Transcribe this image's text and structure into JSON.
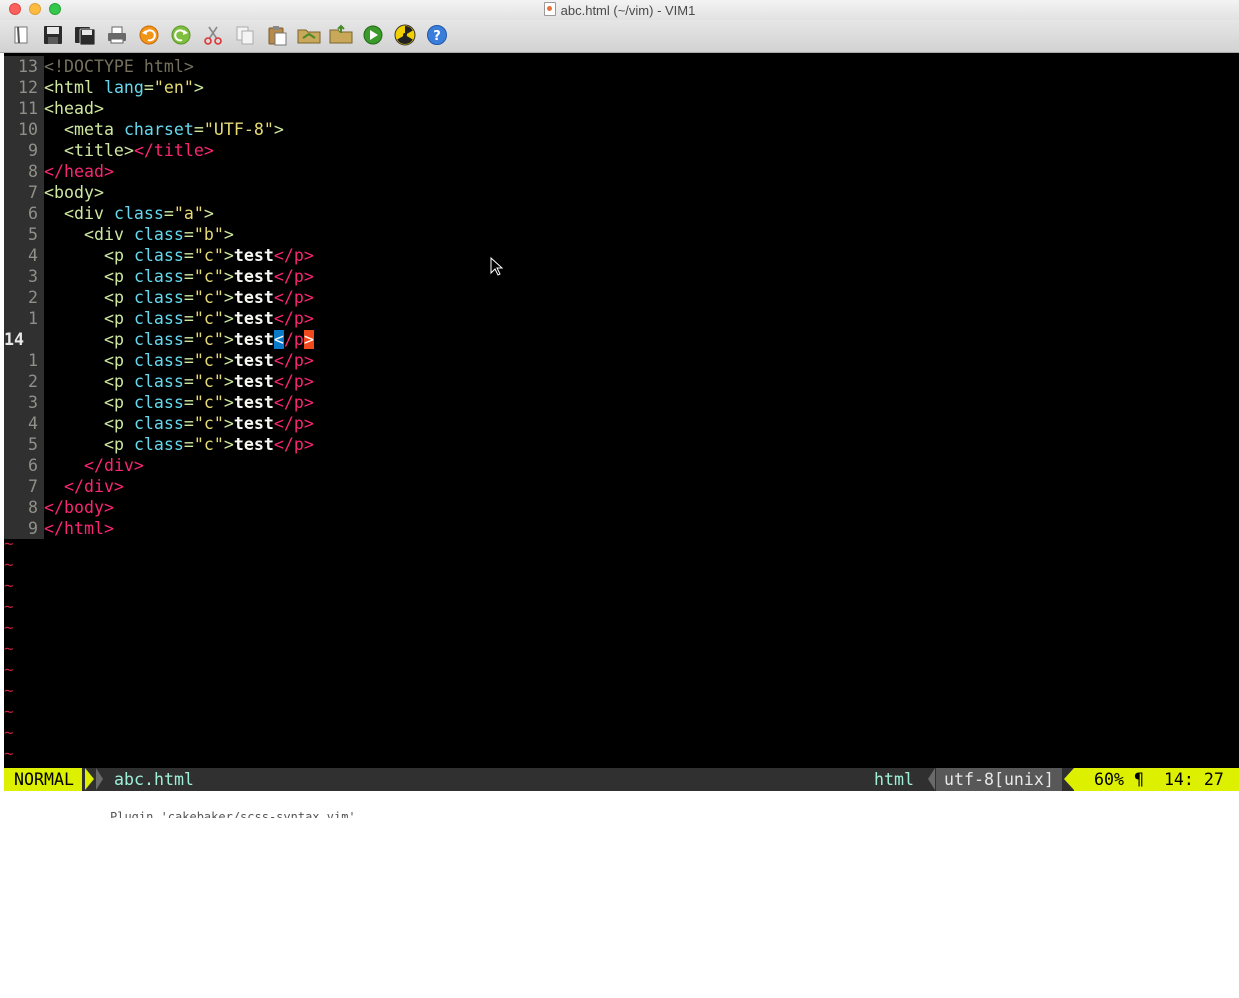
{
  "window": {
    "title": "abc.html (~/vim) - VIM1"
  },
  "toolbar": {
    "buttons": [
      {
        "name": "open-icon"
      },
      {
        "name": "save-icon"
      },
      {
        "name": "save-all-icon"
      },
      {
        "name": "print-icon"
      },
      {
        "name": "undo-icon"
      },
      {
        "name": "redo-icon"
      },
      {
        "name": "cut-icon"
      },
      {
        "name": "copy-icon"
      },
      {
        "name": "paste-icon"
      },
      {
        "name": "load-session-icon"
      },
      {
        "name": "save-session-icon"
      },
      {
        "name": "run-icon"
      },
      {
        "name": "radiation-icon"
      },
      {
        "name": "help-icon"
      }
    ]
  },
  "editor": {
    "lines": [
      {
        "num": "13",
        "text": "<!DOCTYPE html>"
      },
      {
        "num": "12",
        "text": "<html lang=\"en\">"
      },
      {
        "num": "11",
        "text": "<head>"
      },
      {
        "num": "10",
        "text": "  <meta charset=\"UTF-8\">"
      },
      {
        "num": "9",
        "text": "  <title></title>"
      },
      {
        "num": "8",
        "text": "</head>"
      },
      {
        "num": "7",
        "text": "<body>"
      },
      {
        "num": "6",
        "text": "  <div class=\"a\">"
      },
      {
        "num": "5",
        "text": "    <div class=\"b\">"
      },
      {
        "num": "4",
        "text": "      <p class=\"c\">test</p>"
      },
      {
        "num": "3",
        "text": "      <p class=\"c\">test</p>"
      },
      {
        "num": "2",
        "text": "      <p class=\"c\">test</p>"
      },
      {
        "num": "1",
        "text": "      <p class=\"c\">test</p>"
      },
      {
        "num": "14",
        "text": "      <p class=\"c\">test</p>",
        "current": true
      },
      {
        "num": "1",
        "text": "      <p class=\"c\">test</p>"
      },
      {
        "num": "2",
        "text": "      <p class=\"c\">test</p>"
      },
      {
        "num": "3",
        "text": "      <p class=\"c\">test</p>"
      },
      {
        "num": "4",
        "text": "      <p class=\"c\">test</p>"
      },
      {
        "num": "5",
        "text": "      <p class=\"c\">test</p>"
      },
      {
        "num": "6",
        "text": "    </div>"
      },
      {
        "num": "7",
        "text": "  </div>"
      },
      {
        "num": "8",
        "text": "</body>"
      },
      {
        "num": "9",
        "text": "</html>"
      }
    ],
    "tilde": "~",
    "tilde_count": 11
  },
  "statusline": {
    "mode": "NORMAL",
    "filename": "abc.html",
    "filetype": "html",
    "encoding": "utf-8[unix]",
    "percent": "60% ¶",
    "position": "14: 27"
  },
  "bottom_peek": "Plugin 'cakebaker/scss-syntax.vim'",
  "colors": {
    "background": "#000000",
    "gutter": "#303030",
    "tag": "#cfe8a0",
    "attribute": "#66d9ef",
    "string": "#e6db74",
    "closing_tag": "#f92672",
    "tilde": "#c1213c",
    "statusline_accent": "#dcf000"
  }
}
